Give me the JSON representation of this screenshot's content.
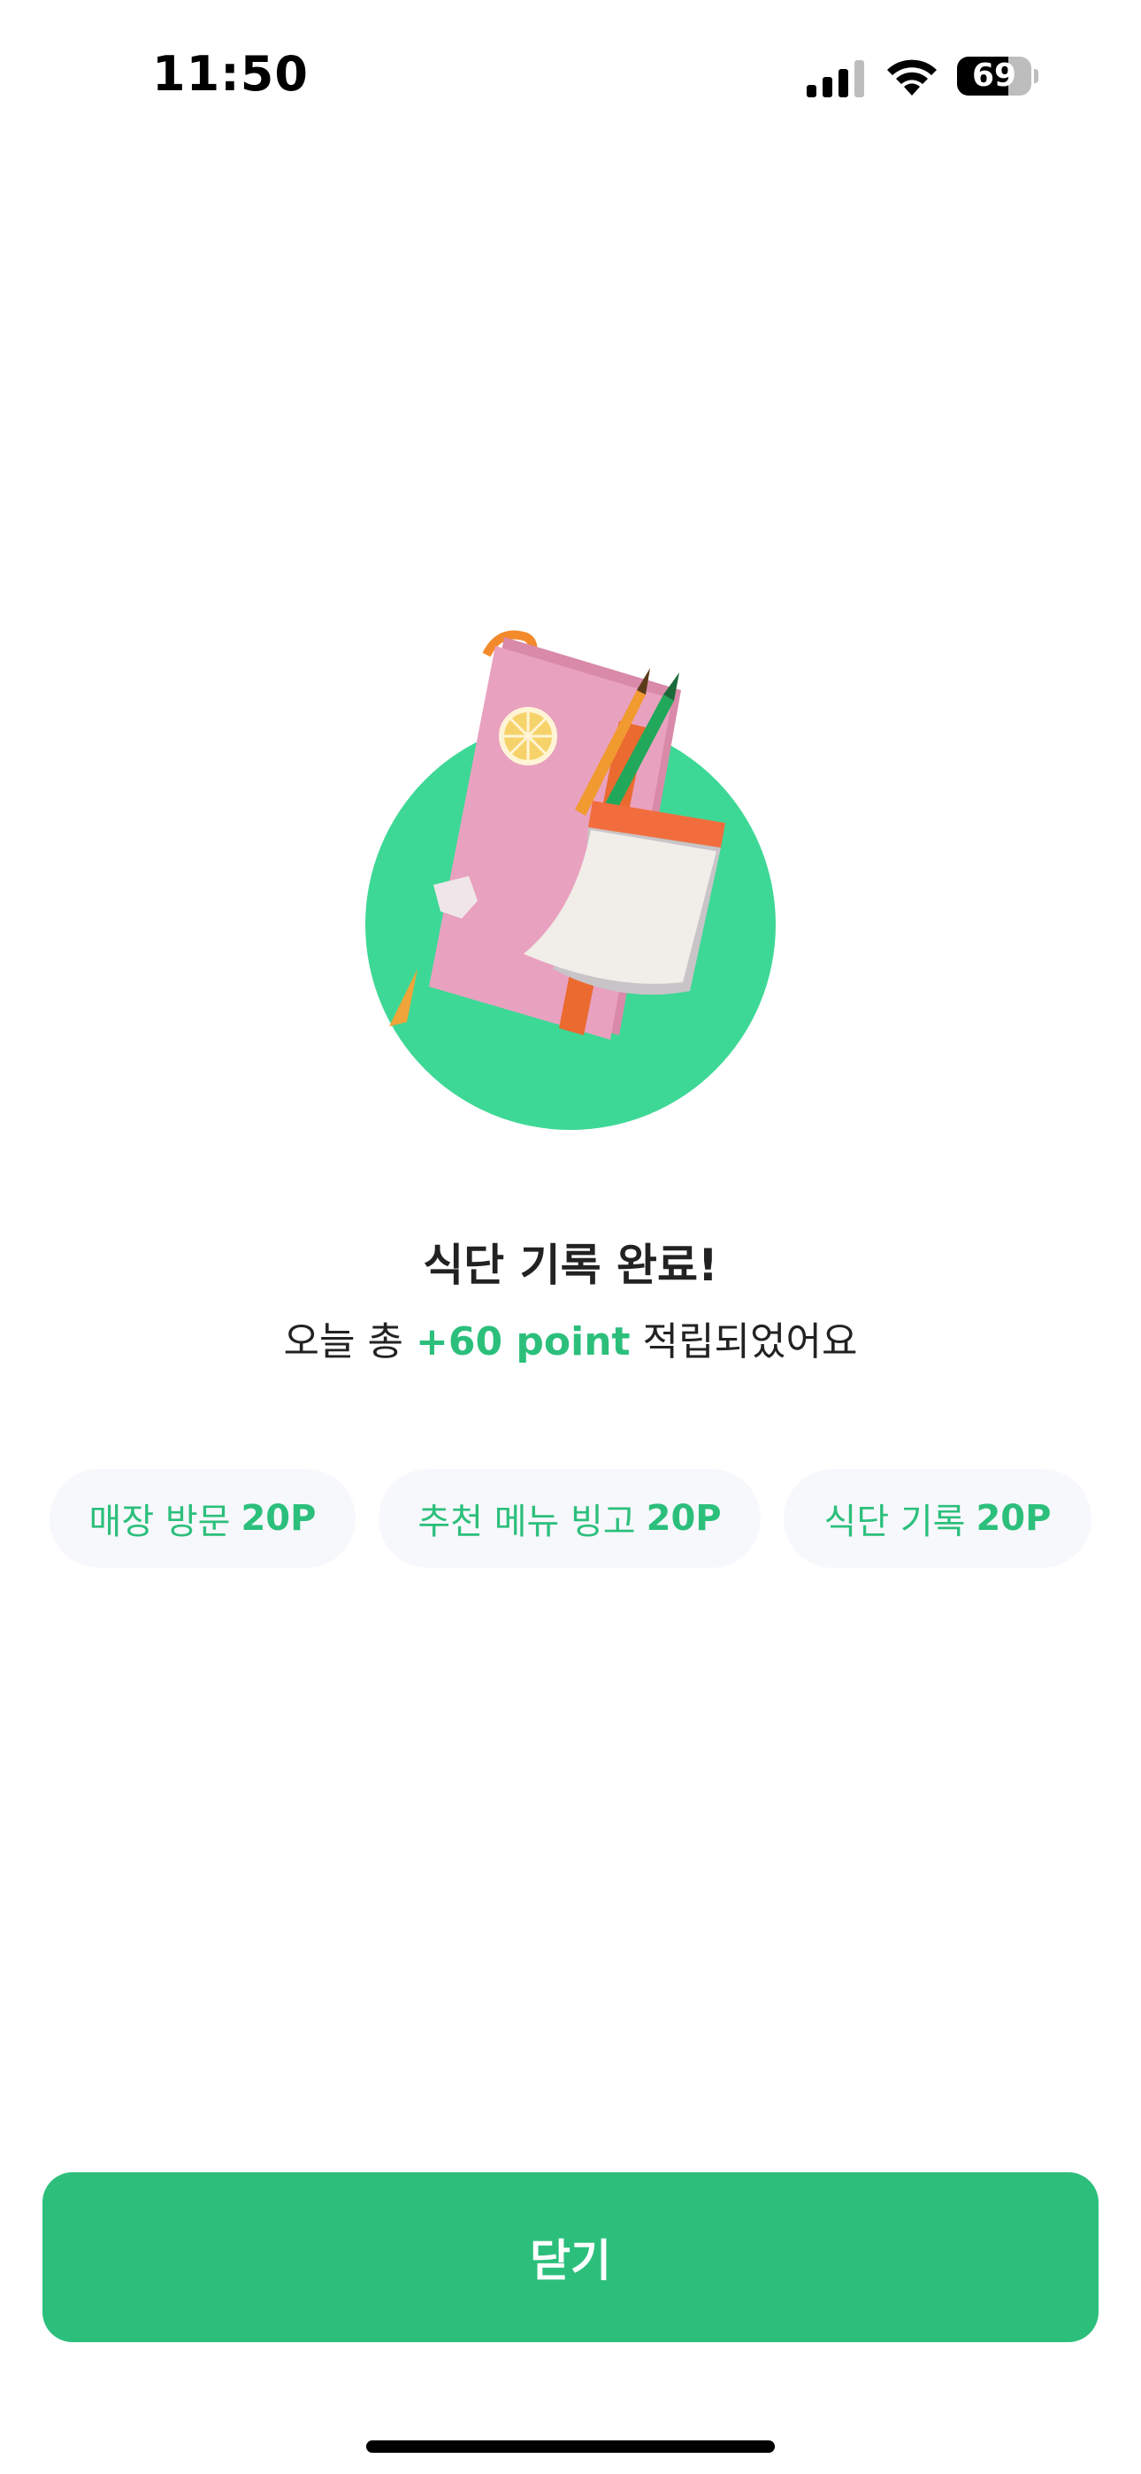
{
  "status_bar": {
    "time": "11:50",
    "battery_level": "69",
    "battery_fraction": 0.69,
    "icons": [
      "signal-icon",
      "wifi-icon",
      "battery-icon"
    ]
  },
  "illustration": {
    "icon": "notebook-pencils-illustration"
  },
  "result": {
    "title": "식단 기록 완료!",
    "subtitle_prefix": "오늘 총 ",
    "subtitle_points": "+60 point",
    "subtitle_suffix": " 적립되었어요"
  },
  "chips": [
    {
      "label": "매장 방문",
      "points": "20P"
    },
    {
      "label": "추천 메뉴 빙고",
      "points": "20P"
    },
    {
      "label": "식단 기록",
      "points": "20P"
    }
  ],
  "close_button": {
    "label": "닫기"
  },
  "colors": {
    "accent": "#2cbf7c",
    "circle": "#3ed896",
    "chip_bg": "#f7f8fb",
    "notebook": "#e79cbc"
  }
}
